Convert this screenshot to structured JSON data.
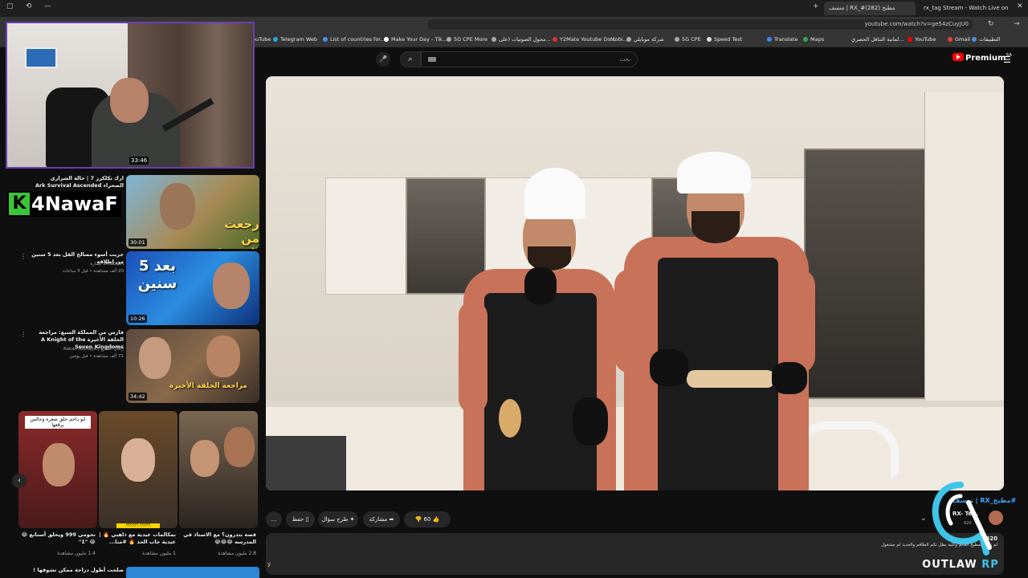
{
  "browser": {
    "tabs": [
      {
        "label": "منسف | RX_#مطبخ (282)"
      },
      {
        "label": "rx_tag Stream - Watch Live on"
      }
    ],
    "url": "youtube.com/watch?v=ge54zCuyjU0",
    "bookmarks": [
      "التطبيقات",
      "Gmail",
      "YouTube",
      "لمانية التناقل الحصري...",
      "Maps",
      "Translate",
      "Speed Test",
      "5G CPE",
      "شركة موبايلي",
      "Mobi...",
      "Y2Mate Youtube Do...",
      "محول الصوتيات (على...",
      "5G CPE More",
      "Make Your Day - Tik...",
      "List of countries for...",
      "Telegram Web",
      "ouTube"
    ]
  },
  "stream": {
    "timer": "33:46",
    "channel_logo_k": "K",
    "channel_logo_name": "4NawaF"
  },
  "recommendations": [
    {
      "title": "ارك تكلكرز 7 | حالة الشرارى الصحراء Ark Survival Ascended",
      "meta": "",
      "duration": "30:01",
      "thumb_text": "رجعت من الصفر!"
    },
    {
      "title": "جربت أسوء مصالح القل بعد 5 سنين من إطلاقه",
      "channel": "SANKARA بشارة",
      "meta": "20 ألف مشاهدة • قبل 3 ساعات",
      "duration": "10:26",
      "thumb_text": "بعد 5 سنين"
    },
    {
      "title": "فارس من المملكة السبع: مراجعة الحلقة الأخيرة A Knight of the Seven Kingdoms",
      "channel": "راكان الشايع | Rakan AlShaya",
      "meta": "71 ألف مشاهدة • قبل يومين",
      "duration": "34:42",
      "thumb_text": "مراجعة الحلقة الأخيرة"
    }
  ],
  "shorts": [
    {
      "title": "ابو داحم حلق شعره وجالس يرقعها",
      "caption": "نحومي 999 ويحلق أسنانع 😂😂 \"1\"",
      "views": "1.4 مليون مشاهدة",
      "banner": "ابو داحم حلق شعره وجالس يرقعها"
    },
    {
      "title": "بمكالمات عيدية مع ذاهبي 🔥 | عيدية جاب الحد 🔥 #منا...",
      "views": "1 مليون مشاهدة",
      "banner": "؟؟؟؟؟ ؟؟؟؟؟؟"
    },
    {
      "title": "قصة بتدرون؟ مع الاستاذ في المدرسه 😂😂😂",
      "views": "2.8 مليون مشاهدة"
    }
  ],
  "bottom_rec_title": "صلحت أطول دراجة ممكن تشوفها !",
  "youtube": {
    "search_placeholder": "بحث",
    "premium_label": "Premium",
    "country": "SA",
    "like_count": "60",
    "share_label": "مشاركة",
    "ask_label": "طرح سؤال",
    "save_label": "حفظ",
    "more_label": "...",
    "channel_name": "#مطبخ_RX | منسف",
    "channel_handle": "RX- Te...",
    "subscribers": "920",
    "desc_views": "920",
    "desc_text": "لم تكن المطبخ العالم وكلية بطل تكم الطاقم والعديد لم مشغول",
    "desc_bottom": "لا"
  },
  "watermark": {
    "brand": "OUTLAW",
    "brand_suffix": "RP"
  }
}
